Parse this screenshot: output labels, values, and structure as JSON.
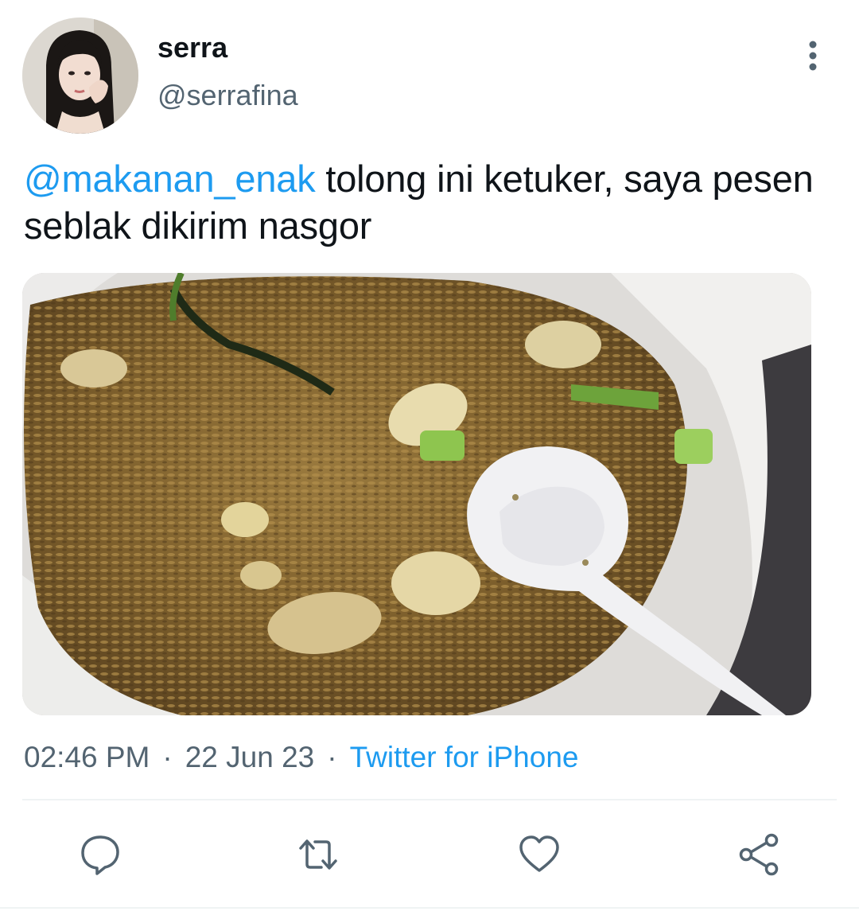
{
  "author": {
    "display_name": "serra",
    "handle": "@serrafina"
  },
  "tweet": {
    "mention": "@makanan_enak",
    "text": " tolong ini ketuker, saya pesen seblak dikirim nasgor"
  },
  "meta": {
    "time": "02:46 PM",
    "separator": "·",
    "date": "22 Jun 23",
    "source": "Twitter for iPhone"
  },
  "actions": {
    "reply_icon": "speech-bubble-icon",
    "retweet_icon": "retweet-arrows-icon",
    "like_icon": "heart-icon",
    "share_icon": "share-nodes-icon"
  },
  "icons": {
    "more": "vertical-ellipsis-icon"
  },
  "colors": {
    "link": "#1d9bf0",
    "secondary_text": "#536471",
    "primary_text": "#0f1419",
    "icon": "#536471"
  }
}
